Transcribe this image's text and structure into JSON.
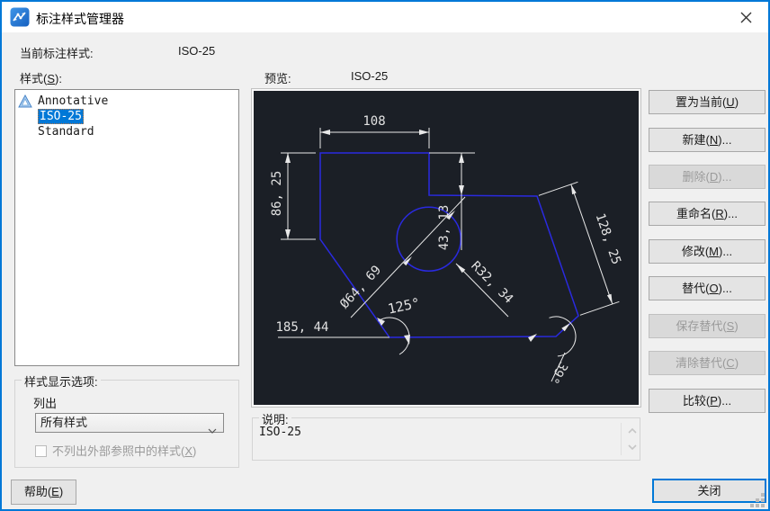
{
  "window": {
    "title": "标注样式管理器"
  },
  "header": {
    "current_label": "当前标注样式:",
    "current_value": "ISO-25",
    "styles_pre": "样式(",
    "styles_key": "S",
    "styles_post": "):",
    "preview_label": "预览:",
    "preview_value": "ISO-25"
  },
  "style_list": {
    "items": [
      {
        "label": "Annotative",
        "icon": "annotative-icon",
        "selected": false
      },
      {
        "label": "ISO-25",
        "selected": true
      },
      {
        "label": "Standard",
        "selected": false
      }
    ]
  },
  "buttons": [
    {
      "pre": "置为当前(",
      "key": "U",
      "post": ")",
      "disabled": false
    },
    {
      "pre": "新建(",
      "key": "N",
      "post": ")...",
      "disabled": false
    },
    {
      "pre": "删除(",
      "key": "D",
      "post": ")...",
      "disabled": true
    },
    {
      "pre": "重命名(",
      "key": "R",
      "post": ")...",
      "disabled": false
    },
    {
      "pre": "修改(",
      "key": "M",
      "post": ")...",
      "disabled": false
    },
    {
      "pre": "替代(",
      "key": "O",
      "post": ")...",
      "disabled": false
    },
    {
      "pre": "保存替代(",
      "key": "S",
      "post": ")",
      "disabled": true
    },
    {
      "pre": "清除替代(",
      "key": "C",
      "post": ")",
      "disabled": true
    },
    {
      "pre": "比较(",
      "key": "P",
      "post": ")...",
      "disabled": false
    }
  ],
  "display_options": {
    "legend": "样式显示选项:",
    "list_label": "列出",
    "combo_value": "所有样式",
    "checkbox_pre": "不列出外部参照中的样式(",
    "checkbox_key": "X",
    "checkbox_post": ")",
    "checkbox_checked": false
  },
  "description": {
    "legend": "说明:",
    "text": "ISO-25"
  },
  "footer": {
    "help_pre": "帮助(",
    "help_key": "E",
    "help_post": ")",
    "close_label": "关闭"
  },
  "preview": {
    "dims": {
      "d108": "108",
      "d86": "86, 25",
      "d43": "43, 13",
      "d128": "128, 25",
      "dia": "Ø64, 69",
      "rad": "R32, 34",
      "a125": "125°",
      "a39": "39°",
      "d185": "185, 44"
    },
    "colors": {
      "background": "#1b1f26",
      "geometry": "#2a2ae0",
      "dimension": "#e8e8e8"
    }
  },
  "colors": {
    "accent": "#0078d7",
    "dialog_bg": "#f0f0f0",
    "selection": "#0078d7",
    "disabled_text": "#9a9a9a"
  }
}
